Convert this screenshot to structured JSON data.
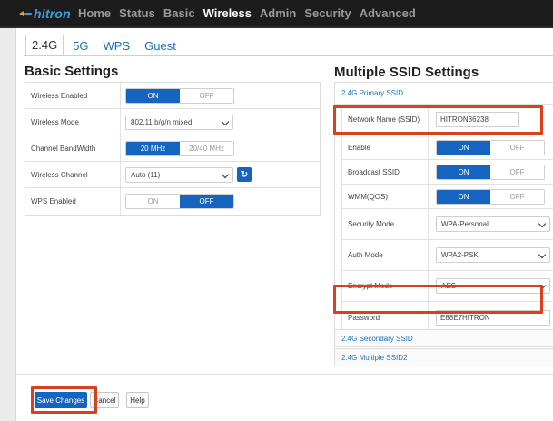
{
  "brand": {
    "logo_text": "hitron"
  },
  "nav": {
    "items": [
      "Home",
      "Status",
      "Basic",
      "Wireless",
      "Admin",
      "Security",
      "Advanced"
    ],
    "active": "Wireless"
  },
  "subtabs": {
    "items": [
      "2.4G",
      "5G",
      "WPS",
      "Guest"
    ],
    "active": "2.4G"
  },
  "basic": {
    "title": "Basic Settings",
    "rows": {
      "wireless_enabled": {
        "label": "Wireless Enabled",
        "on": "ON",
        "off": "OFF",
        "value": "ON"
      },
      "wireless_mode": {
        "label": "Wireless Mode",
        "value": "802.11 b/g/n mixed"
      },
      "channel_bandwidth": {
        "label": "Channel BandWidth",
        "opt1": "20 MHz",
        "opt2": "20/40 MHz",
        "value": "20 MHz"
      },
      "wireless_channel": {
        "label": "Wireless Channel",
        "value": "Auto (11)"
      },
      "wps_enabled": {
        "label": "WPS Enabled",
        "on": "ON",
        "off": "OFF",
        "value": "OFF"
      }
    }
  },
  "ssid": {
    "title": "Multiple SSID Settings",
    "primary_header": "2.4G Primary SSID",
    "rows": {
      "network_name": {
        "label": "Network Name (SSID)",
        "value": "HITRON36238"
      },
      "enable": {
        "label": "Enable",
        "on": "ON",
        "off": "OFF",
        "value": "ON"
      },
      "broadcast": {
        "label": "Broadcast SSID",
        "on": "ON",
        "off": "OFF",
        "value": "ON"
      },
      "wmm": {
        "label": "WMM(QOS)",
        "on": "ON",
        "off": "OFF",
        "value": "ON"
      },
      "security_mode": {
        "label": "Security Mode",
        "value": "WPA-Personal"
      },
      "auth_mode": {
        "label": "Auth Mode",
        "value": "WPA2-PSK"
      },
      "encrypt_mode": {
        "label": "Encrypt Mode",
        "value": "AES"
      },
      "password": {
        "label": "Password",
        "value": "E88E7HITRON"
      }
    },
    "secondary_header": "2.4G Secondary SSID",
    "multiple2_header": "2.4G Multiple SSID2"
  },
  "footer": {
    "save": "Save Changes",
    "cancel": "Cancel",
    "help": "Help"
  },
  "colors": {
    "accent": "#1565c0",
    "highlight": "#d9411e",
    "link": "#1a73b8",
    "topbar": "#1c1c1c"
  }
}
